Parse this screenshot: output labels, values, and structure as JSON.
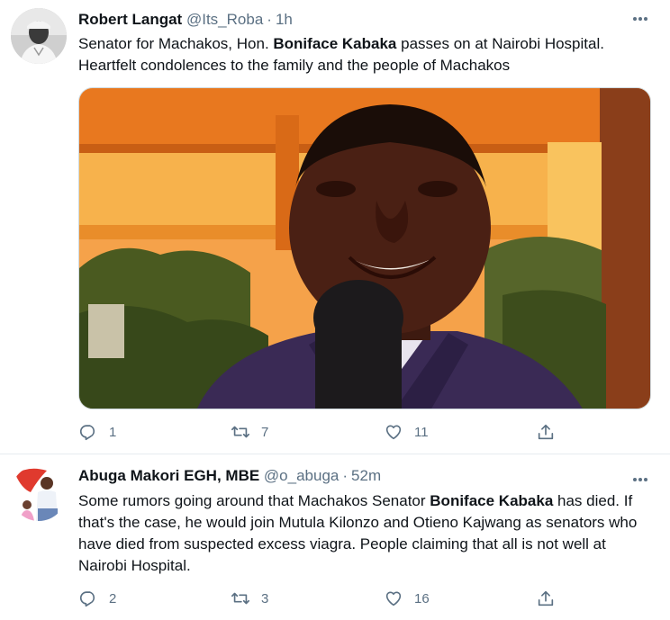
{
  "tweets": [
    {
      "author": {
        "name": "Robert Langat",
        "handle": "@Its_Roba",
        "time": "1h"
      },
      "text": {
        "p1": "Senator for Machakos, Hon. ",
        "bold": "Boniface Kabaka",
        "p2": " passes on at Nairobi Hospital. Heartfelt condolences to the family and the people of Machakos"
      },
      "stats": {
        "replies": "1",
        "retweets": "7",
        "likes": "11"
      }
    },
    {
      "author": {
        "name": "Abuga Makori EGH, MBE",
        "handle": "@o_abuga",
        "time": "52m"
      },
      "text": {
        "p1": "Some rumors going around that Machakos Senator ",
        "bold": "Boniface Kabaka",
        "p2": " has died. If that's the case, he would join Mutula Kilonzo and Otieno Kajwang as senators who have died from suspected excess viagra. People claiming that all is not well at Nairobi Hospital."
      },
      "stats": {
        "replies": "2",
        "retweets": "3",
        "likes": "16"
      }
    }
  ],
  "separator": "·",
  "colors": {
    "secondary_text": "#5b7083",
    "border": "#e6ecf0",
    "text": "#0f1419"
  },
  "icons": {
    "reply": "reply-icon",
    "retweet": "retweet-icon",
    "like": "heart-icon",
    "share": "share-icon",
    "more": "more-icon"
  }
}
